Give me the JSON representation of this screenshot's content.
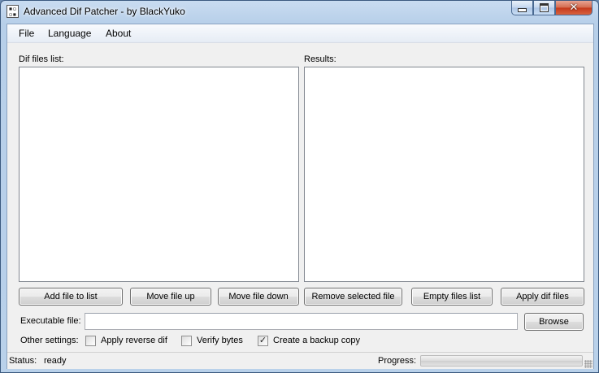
{
  "window": {
    "title": "Advanced Dif Patcher - by BlackYuko"
  },
  "menu": {
    "items": [
      "File",
      "Language",
      "About"
    ]
  },
  "left_panel": {
    "label": "Dif files list:",
    "items": []
  },
  "right_panel": {
    "label": "Results:",
    "items": []
  },
  "buttons": {
    "add": "Add file to list",
    "up": "Move file up",
    "down": "Move file down",
    "remove": "Remove selected file",
    "empty": "Empty files list",
    "apply": "Apply dif files",
    "browse": "Browse"
  },
  "executable": {
    "label": "Executable file:",
    "value": "",
    "placeholder": ""
  },
  "settings": {
    "label": "Other settings:",
    "reverse": {
      "label": "Apply reverse dif",
      "checked": false
    },
    "verify": {
      "label": "Verify bytes",
      "checked": false
    },
    "backup": {
      "label": "Create a backup copy",
      "checked": true
    }
  },
  "status": {
    "label": "Status:",
    "value": "ready"
  },
  "progress": {
    "label": "Progress:",
    "fraction": 0
  }
}
